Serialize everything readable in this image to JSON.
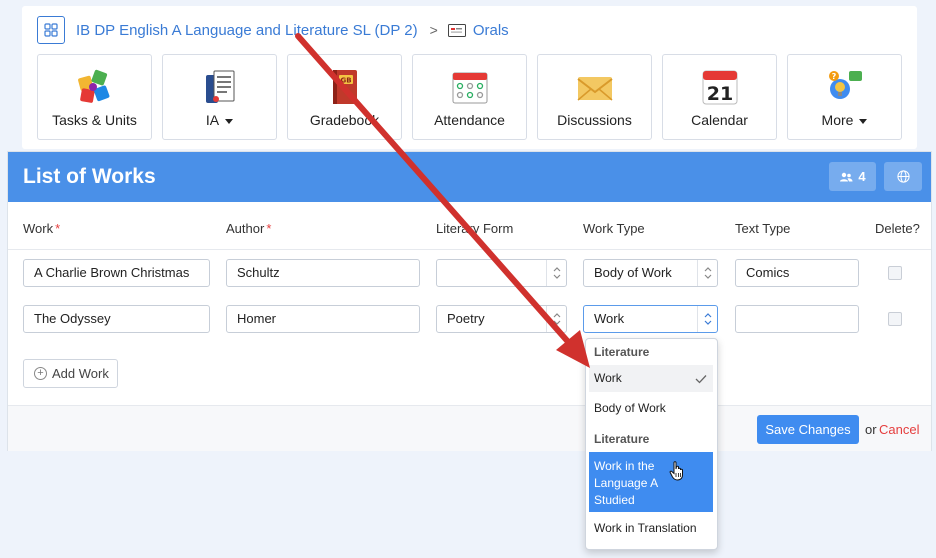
{
  "breadcrumb": {
    "course": "IB DP English A Language and Literature SL (DP 2)",
    "separator": ">",
    "current": "Orals"
  },
  "tiles": [
    {
      "label": "Tasks & Units",
      "icon": "puzzle-icon",
      "caret": false
    },
    {
      "label": "IA",
      "icon": "ia-document-icon",
      "caret": true
    },
    {
      "label": "Gradebook",
      "icon": "gradebook-icon",
      "caret": false
    },
    {
      "label": "Attendance",
      "icon": "attendance-icon",
      "caret": false
    },
    {
      "label": "Discussions",
      "icon": "envelope-icon",
      "caret": false
    },
    {
      "label": "Calendar",
      "icon": "calendar-icon",
      "caret": false,
      "day": "21"
    },
    {
      "label": "More",
      "icon": "more-icon",
      "caret": true
    }
  ],
  "panel": {
    "title": "List of Works",
    "member_count": "4"
  },
  "columns": {
    "work": "Work",
    "author": "Author",
    "form": "Literary Form",
    "work_type": "Work Type",
    "text_type": "Text Type",
    "delete": "Delete?",
    "required_mark": "*"
  },
  "rows": [
    {
      "work": "A Charlie Brown Christmas",
      "author": "Schultz",
      "form": "",
      "work_type": "Body of Work",
      "text_type": "Comics"
    },
    {
      "work": "The Odyssey",
      "author": "Homer",
      "form": "Poetry",
      "work_type": "Work",
      "text_type": ""
    }
  ],
  "add_work_label": "Add Work",
  "footer": {
    "save_label": "Save Changes",
    "or_label": "or",
    "cancel_label": "Cancel"
  },
  "dropdown": {
    "group1": "Literature",
    "item1": "Work",
    "item2": "Body of Work",
    "group2": "Literature",
    "item3_lines": [
      "Work in the",
      "Language A",
      "Studied"
    ],
    "item4": "Work in Translation"
  },
  "colors": {
    "accent": "#4a90e8",
    "link": "#3a7bd5",
    "danger": "#e53e3e",
    "annotation_arrow": "#d0312d"
  }
}
